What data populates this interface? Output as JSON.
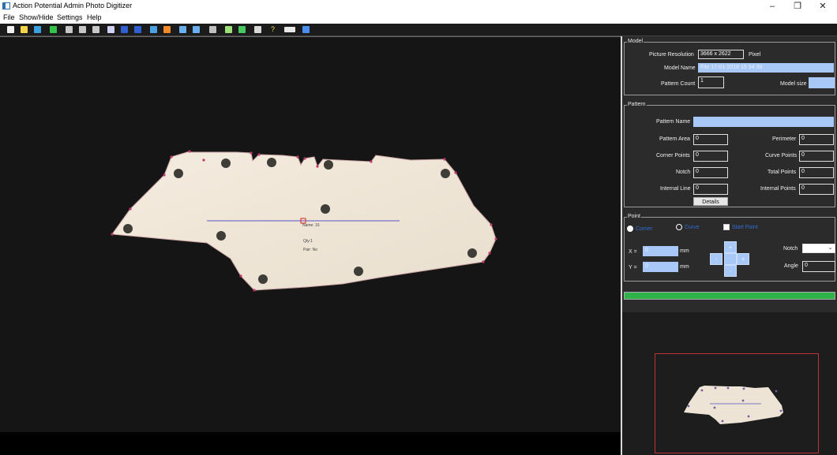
{
  "window": {
    "title": "Action Potential Admin Photo Digitizer",
    "minimize": "–",
    "maximize": "❐",
    "close": "✕"
  },
  "menu": [
    "File",
    "Show/Hide",
    "Settings",
    "Help"
  ],
  "toolbar_icons": [
    {
      "name": "new-icon",
      "color": "#f0f0f0"
    },
    {
      "name": "open-icon",
      "color": "#f3d34a"
    },
    {
      "name": "save-icon",
      "color": "#3aa0e0"
    },
    {
      "name": "run-icon",
      "color": "#35c44b"
    },
    {
      "name": "grid-icon",
      "color": "#c8c8c8"
    },
    {
      "name": "table-icon",
      "color": "#c8c8c8"
    },
    {
      "name": "frame-icon",
      "color": "#c8c8c8"
    },
    {
      "name": "target-icon",
      "color": "#d0d0f0"
    },
    {
      "name": "point-icon",
      "color": "#2f5fd0"
    },
    {
      "name": "pen-icon",
      "color": "#2f5fd0"
    },
    {
      "name": "axis-icon",
      "color": "#4aa0e0"
    },
    {
      "name": "corner-icon",
      "color": "#f08a2a"
    },
    {
      "name": "undo-icon",
      "color": "#6ab0f0"
    },
    {
      "name": "redo-icon",
      "color": "#6ab0f0"
    },
    {
      "name": "tools-icon",
      "color": "#c0c0c0"
    },
    {
      "name": "image-icon",
      "color": "#9ee07a"
    },
    {
      "name": "export-icon",
      "color": "#48c860"
    },
    {
      "name": "camera-icon",
      "color": "#d8d8d8"
    },
    {
      "name": "help-icon",
      "color": "#f2e04a"
    },
    {
      "name": "ruler-icon",
      "color": "#e8e8e8"
    },
    {
      "name": "lines-icon",
      "color": "#4a8ef0"
    }
  ],
  "canvas": {
    "annotation_name": "Name: 16",
    "annotation_qty": "Qty:1",
    "annotation_pair": "Pair: No"
  },
  "model": {
    "legend": "Model",
    "resolution_label": "Picture Resolution",
    "resolution_value": "3666 x 2622",
    "resolution_unit": "Pixel",
    "name_label": "Model Name",
    "name_value": "File 17-01-2018 15 34 39",
    "pattern_count_label": "Pattern Count",
    "pattern_count_value": "1",
    "model_size_label": "Model size",
    "model_size_value": ""
  },
  "pattern": {
    "legend": "Pattern",
    "name_label": "Pattern Name",
    "name_value": "",
    "area_label": "Pattern Area",
    "area_value": "0",
    "perimeter_label": "Perimeter",
    "perimeter_value": "0",
    "corner_label": "Corner Points",
    "corner_value": "0",
    "curve_label": "Curve Points",
    "curve_value": "0",
    "notch_label": "Notch",
    "notch_value": "0",
    "total_label": "Total Points",
    "total_value": "0",
    "internal_line_label": "Internal Line",
    "internal_line_value": "0",
    "internal_points_label": "Internal Points",
    "internal_points_value": "0",
    "details_button": "Details"
  },
  "point": {
    "legend": "Point",
    "corner_label": "Corner",
    "curve_label": "Curve",
    "start_label": "Start Point",
    "x_label": "X =",
    "x_value": "0",
    "y_label": "Y =",
    "y_value": "0",
    "unit_mm": "mm",
    "notch_label": "Notch",
    "notch_value": "",
    "angle_label": "Angle",
    "angle_value": "0",
    "pad_up": "+",
    "pad_down": "-",
    "pad_left": "-",
    "pad_right": "+"
  },
  "progress": {
    "fraction": 1.0,
    "color": "#2db34a"
  }
}
